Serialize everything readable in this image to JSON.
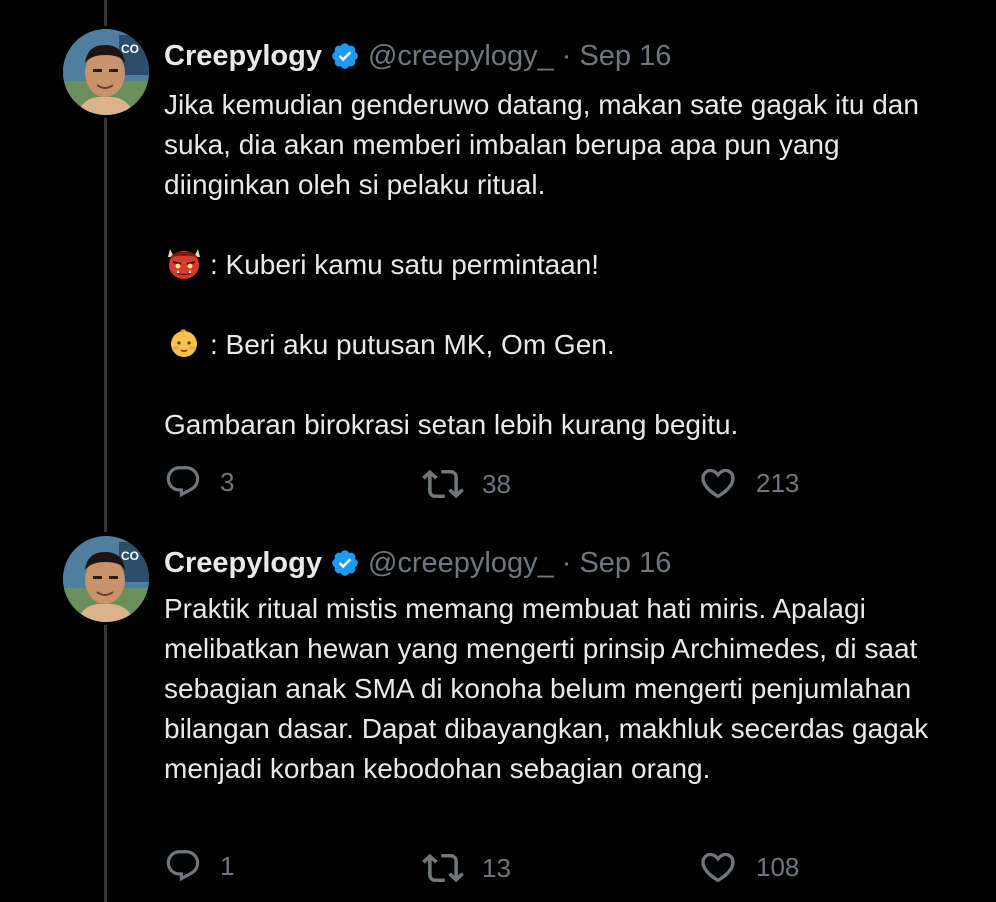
{
  "colors": {
    "background": "#000000",
    "text": "#e7e9ea",
    "muted": "#71767b",
    "verified": "#1d9bf0",
    "thread_line": "#333639"
  },
  "tweets": [
    {
      "author": {
        "name": "Creepylogy",
        "handle": "@creepylogy_",
        "verified_icon": "verified-badge-icon",
        "avatar_icon": "avatar"
      },
      "separator": "·",
      "date": "Sep 16",
      "paragraphs": [
        "Jika kemudian genderuwo datang, makan sate gagak itu dan suka, dia akan memberi imbalan berupa apa pun yang diinginkan oleh si pelaku ritual.",
        ": Kuberi kamu satu permintaan!",
        ": Beri aku putusan MK, Om Gen.",
        "Gambaran birokrasi setan lebih kurang begitu."
      ],
      "emojis": [
        "ogre-emoji",
        "baby-emoji"
      ],
      "stats": {
        "replies": "3",
        "retweets": "38",
        "likes": "213"
      }
    },
    {
      "author": {
        "name": "Creepylogy",
        "handle": "@creepylogy_",
        "verified_icon": "verified-badge-icon",
        "avatar_icon": "avatar"
      },
      "separator": "·",
      "date": "Sep 16",
      "paragraphs": [
        "Praktik ritual mistis memang membuat hati miris. Apalagi melibatkan hewan yang mengerti prinsip Archimedes, di saat sebagian anak SMA di konoha belum mengerti penjumlahan bilangan dasar. Dapat dibayangkan, makhluk secerdas gagak menjadi korban kebodohan sebagian orang."
      ],
      "stats": {
        "replies": "1",
        "retweets": "13",
        "likes": "108"
      }
    }
  ],
  "icons": {
    "reply": "reply-icon",
    "retweet": "retweet-icon",
    "like": "heart-icon"
  }
}
